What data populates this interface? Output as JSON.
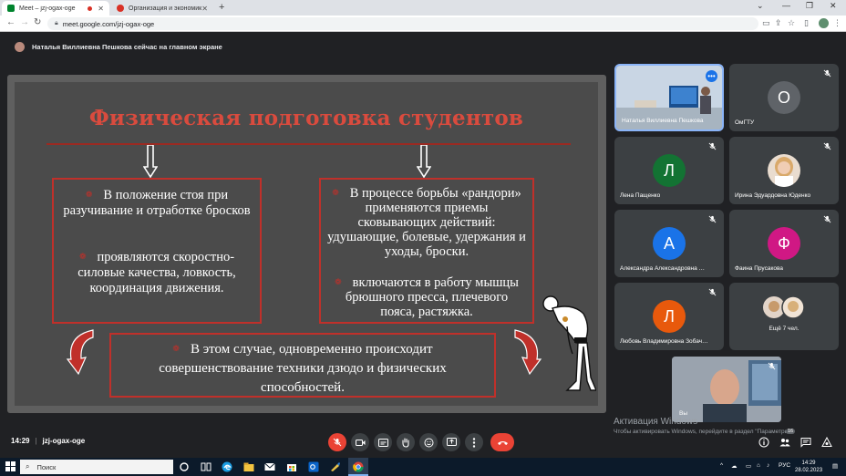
{
  "browser": {
    "tabs": [
      {
        "title": "Meet – jzj-ogax-oge",
        "active": true
      },
      {
        "title": "Организация и экономика ФК…",
        "active": false
      }
    ],
    "new_tab_glyph": "+",
    "url": "meet.google.com/jzj-ogax-oge"
  },
  "banner": {
    "text": "Наталья Виллиевна Пешкова сейчас на главном экране"
  },
  "slide": {
    "title": "Физическая подготовка студентов",
    "left_box": {
      "p1": "В положение стоя при разучивание и отработке бросков",
      "p2": "проявляются скоростно-силовые качества, ловкость, координация движения."
    },
    "right_box": {
      "p1": "В процессе борьбы «рандори» применяются приемы сковывающих действий: удушающие, болевые, удержания и уходы,  броски.",
      "p2": "включаются в работу мышцы брюшного пресса, плечевого пояса,  растяжка."
    },
    "bottom_box": {
      "p1": "В этом случае,  одновременно происходит совершенствование техники дзюдо и физических способностей."
    },
    "colors": {
      "accent": "#c0302a",
      "title": "#d94b3e",
      "background": "#4b4b4b"
    }
  },
  "participants": [
    {
      "name": "Наталья Виллиевна Пешкова",
      "type": "video"
    },
    {
      "name": "ОмГТУ",
      "initial": "О",
      "color": "#5f6368"
    },
    {
      "name": "Лена Пащенко",
      "initial": "Л",
      "color": "#137333"
    },
    {
      "name": "Ирина Эдуардовна Юденко",
      "type": "photo"
    },
    {
      "name": "Александра Александровна …",
      "initial": "А",
      "color": "#1a73e8"
    },
    {
      "name": "Фаина Прусакова",
      "initial": "Ф",
      "color": "#d01884"
    },
    {
      "name": "Любовь Владимировна Зобач…",
      "initial": "Л",
      "color": "#e8590c"
    },
    {
      "name": "Ещё 7 чел.",
      "type": "more"
    }
  ],
  "self_view": {
    "label": "Вы"
  },
  "watermark": {
    "title": "Активация Windows",
    "subtitle": "Чтобы активировать Windows, перейдите в раздел \"Параметры\"."
  },
  "meeting": {
    "time": "14:29",
    "code": "jzj-ogax-oge",
    "participant_count": "16"
  },
  "taskbar": {
    "search_placeholder": "Поиск",
    "language": "РУС",
    "time": "14:29",
    "date": "28.02.2023"
  }
}
